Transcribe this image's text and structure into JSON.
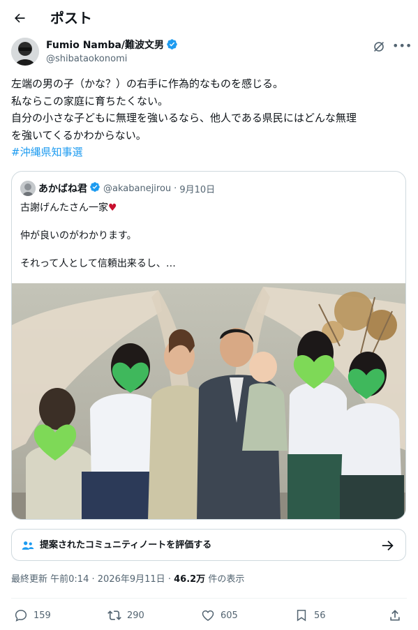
{
  "header": {
    "title": "ポスト"
  },
  "author": {
    "name": "Fumio Namba/難波文男",
    "handle": "@shibataokonomi"
  },
  "tweet": {
    "lines": [
      "左端の男の子（かな？）の右手に作為的なものを感じる。",
      "私ならこの家庭に育ちたくない。",
      "自分の小さな子どもに無理を強いるなら、他人である県民にはどんな無理",
      "を強いてくるかわからない。"
    ],
    "hashtag": "#沖縄県知事選"
  },
  "quote": {
    "name": "あかばね君",
    "handle": "@akabanejirou",
    "separator": "·",
    "date": "9月10日",
    "line1": "古謝げんたさん一家",
    "heart": "♥",
    "line2": "仲が良いのがわかります。",
    "line3": "それって人として信頼出来るし、…"
  },
  "community_note": {
    "label": "提案されたコミュニティノートを評価する"
  },
  "meta": {
    "prefix": "最終更新",
    "time": "午前0:14",
    "sep": "·",
    "date": "2026年9月11日",
    "views": "46.2万",
    "views_suffix": "件の表示"
  },
  "actions": {
    "replies": "159",
    "reposts": "290",
    "likes": "605",
    "bookmarks": "56"
  },
  "colors": {
    "accent": "#1d9bf0",
    "text": "#0f1419",
    "muted": "#536471",
    "border": "#cfd9de",
    "heart_emoji": "#c8102e",
    "face_sticker": "#7ed957"
  }
}
